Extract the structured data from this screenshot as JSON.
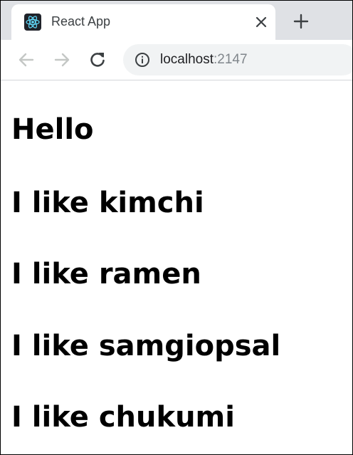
{
  "browser": {
    "tab": {
      "favicon": "react-logo-icon",
      "title": "React App",
      "close_icon": "close-icon"
    },
    "new_tab_icon": "plus-icon",
    "toolbar": {
      "back_icon": "arrow-left-icon",
      "forward_icon": "arrow-right-icon",
      "reload_icon": "reload-icon",
      "info_icon": "info-icon",
      "url_host": "localhost",
      "url_port": ":2147"
    }
  },
  "page": {
    "heading": "Hello",
    "foods": [
      "I like kimchi",
      "I like ramen",
      "I like samgiopsal",
      "I like chukumi"
    ]
  },
  "colors": {
    "tab_strip": "#dfe1e5",
    "omnibox": "#f1f3f4",
    "react_cyan": "#61dafb",
    "text": "#000000"
  }
}
